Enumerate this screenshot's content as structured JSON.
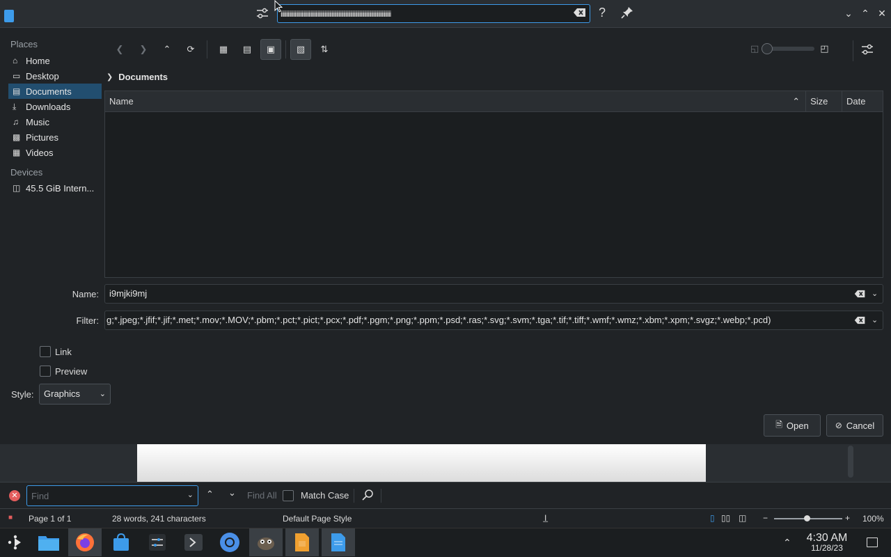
{
  "popup": {
    "search_value": "iiiiiiiiiiiiiiiiiiiiiiiiiiiiiiiiiiiiiiiiiiiiiiiiiiiiiiiiiiiiiiiiiiiiiiiiiiiiiiiiiiiiiiiiiiiiiii"
  },
  "sidebar": {
    "places_title": "Places",
    "places": [
      {
        "label": "Home",
        "icon": "home-icon"
      },
      {
        "label": "Desktop",
        "icon": "desktop-icon"
      },
      {
        "label": "Documents",
        "icon": "documents-icon"
      },
      {
        "label": "Downloads",
        "icon": "downloads-icon"
      },
      {
        "label": "Music",
        "icon": "music-icon"
      },
      {
        "label": "Pictures",
        "icon": "pictures-icon"
      },
      {
        "label": "Videos",
        "icon": "videos-icon"
      }
    ],
    "devices_title": "Devices",
    "devices": [
      {
        "label": "45.5 GiB Intern...",
        "icon": "drive-icon"
      }
    ]
  },
  "breadcrumb": {
    "current": "Documents"
  },
  "filelist": {
    "columns": [
      "Name",
      "Size",
      "Date"
    ]
  },
  "form": {
    "name_label": "Name:",
    "name_value": "i9mjki9mj",
    "filter_label": "Filter:",
    "filter_value": "g;*.jpeg;*.jfif;*.jif;*.met;*.mov;*.MOV;*.pbm;*.pct;*.pict;*.pcx;*.pdf;*.pgm;*.png;*.ppm;*.psd;*.ras;*.svg;*.svm;*.tga;*.tif;*.tiff;*.wmf;*.wmz;*.xbm;*.xpm;*.svgz;*.webp;*.pcd)",
    "link_label": "Link",
    "preview_label": "Preview",
    "style_label": "Style:",
    "style_value": "Graphics"
  },
  "actions": {
    "open": "Open",
    "cancel": "Cancel"
  },
  "findbar": {
    "placeholder": "Find",
    "find_all": "Find All",
    "match_case": "Match Case"
  },
  "status": {
    "page": "Page 1 of 1",
    "words": "28 words, 241 characters",
    "page_style": "Default Page Style",
    "zoom": "100%"
  },
  "taskbar": {
    "time": "4:30 AM",
    "date": "11/28/23"
  },
  "colors": {
    "accent": "#3d9bea",
    "selection": "#224e6f"
  }
}
